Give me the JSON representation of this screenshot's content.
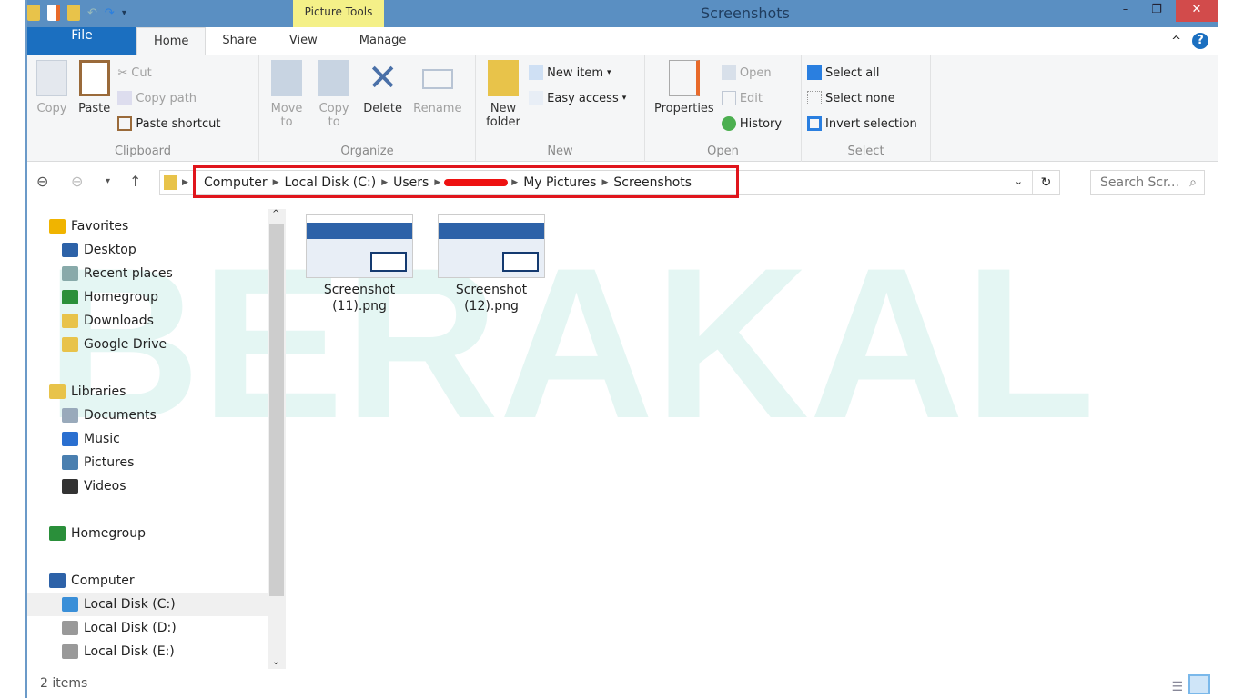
{
  "window": {
    "title": "Screenshots",
    "context_tab": "Picture Tools"
  },
  "tabs": [
    {
      "label": "File"
    },
    {
      "label": "Home"
    },
    {
      "label": "Share"
    },
    {
      "label": "View"
    },
    {
      "label": "Manage"
    }
  ],
  "ribbon": {
    "clipboard": {
      "label": "Clipboard",
      "copy": "Copy",
      "paste": "Paste",
      "cut": "Cut",
      "copy_path": "Copy path",
      "paste_shortcut": "Paste shortcut"
    },
    "organize": {
      "label": "Organize",
      "move_to": "Move to",
      "copy_to": "Copy to",
      "delete": "Delete",
      "rename": "Rename"
    },
    "new": {
      "label": "New",
      "new_folder": "New folder",
      "new_item": "New item",
      "easy_access": "Easy access"
    },
    "open": {
      "label": "Open",
      "properties": "Properties",
      "open": "Open",
      "edit": "Edit",
      "history": "History"
    },
    "select": {
      "label": "Select",
      "select_all": "Select all",
      "select_none": "Select none",
      "invert": "Invert selection"
    }
  },
  "address": {
    "crumbs": [
      "Computer",
      "Local Disk (C:)",
      "Users",
      "My Pictures",
      "Screenshots"
    ],
    "search_placeholder": "Search Scr..."
  },
  "nav": [
    {
      "label": "Favorites",
      "level": 0,
      "color": "#f0b400"
    },
    {
      "label": "Desktop",
      "level": 1,
      "color": "#2d62a8"
    },
    {
      "label": "Recent places",
      "level": 1,
      "color": "#8aa"
    },
    {
      "label": "Homegroup",
      "level": 1,
      "color": "#2a8f3a"
    },
    {
      "label": "Downloads",
      "level": 1,
      "color": "#e8c34a"
    },
    {
      "label": "Google Drive",
      "level": 1,
      "color": "#e8c34a"
    },
    {
      "label": "",
      "level": 0,
      "color": ""
    },
    {
      "label": "Libraries",
      "level": 0,
      "color": "#e8c34a"
    },
    {
      "label": "Documents",
      "level": 1,
      "color": "#9ab"
    },
    {
      "label": "Music",
      "level": 1,
      "color": "#2a6fd0"
    },
    {
      "label": "Pictures",
      "level": 1,
      "color": "#4a7fb0"
    },
    {
      "label": "Videos",
      "level": 1,
      "color": "#333"
    },
    {
      "label": "",
      "level": 0,
      "color": ""
    },
    {
      "label": "Homegroup",
      "level": 0,
      "color": "#2a8f3a"
    },
    {
      "label": "",
      "level": 0,
      "color": ""
    },
    {
      "label": "Computer",
      "level": 0,
      "color": "#2d62a8"
    },
    {
      "label": "Local Disk (C:)",
      "level": 1,
      "color": "#3a8fd8",
      "selected": true
    },
    {
      "label": "Local Disk (D:)",
      "level": 1,
      "color": "#999"
    },
    {
      "label": "Local Disk (E:)",
      "level": 1,
      "color": "#999"
    }
  ],
  "files": [
    {
      "name": "Screenshot (11).png"
    },
    {
      "name": "Screenshot (12).png"
    }
  ],
  "status": {
    "count": "2 items"
  },
  "watermark": "BERAKAL"
}
